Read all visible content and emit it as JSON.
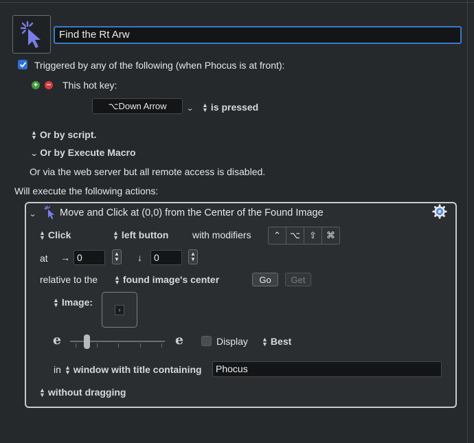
{
  "macro": {
    "name": "Find the Rt Arw",
    "icon": "cursor-click-icon"
  },
  "trigger": {
    "checkbox_label": "Triggered by any of the following (when Phocus is at front):",
    "checked": true,
    "hotkey_label": "This hot key:",
    "hotkey_value": "⌥Down Arrow",
    "hotkey_condition": "is pressed",
    "or_by_script": "Or by script.",
    "or_by_execute_macro": "Or by Execute Macro",
    "web_server_note": "Or via the web server but all remote access is disabled."
  },
  "actions_header": "Will execute the following actions:",
  "action": {
    "title": "Move and Click at (0,0) from the Center of the Found Image",
    "click_type": "Click",
    "button": "left button",
    "with_modifiers_label": "with modifiers",
    "modifiers": [
      "⌃",
      "⌥",
      "⇧",
      "⌘"
    ],
    "at_label": "at",
    "x_arrow": "→",
    "x_value": "0",
    "y_arrow": "↓",
    "y_value": "0",
    "relative_label": "relative to the",
    "relative_to": "found image's center",
    "go_label": "Go",
    "get_label": "Get",
    "image_label": "Image:",
    "fuzz_low_glyph": "e",
    "fuzz_high_glyph": "e",
    "display_label": "Display",
    "display_checked": false,
    "best_label": "Best",
    "in_label": "in",
    "window_condition": "window with title containing",
    "window_title": "Phocus",
    "drag_option": "without dragging"
  },
  "colors": {
    "background": "#25292c",
    "accent": "#2f6fd6",
    "name_field_border": "#3a7ac8",
    "gear": "#5a8de0"
  }
}
